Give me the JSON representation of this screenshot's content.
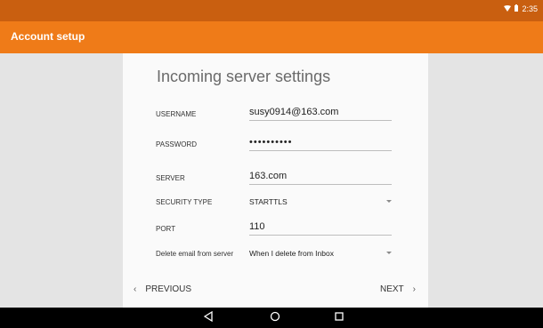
{
  "status_bar": {
    "time": "2:35",
    "icons": [
      "wifi-icon",
      "battery-icon"
    ]
  },
  "app_bar": {
    "title": "Account setup"
  },
  "form": {
    "heading": "Incoming server settings",
    "username": {
      "label": "USERNAME",
      "value": "susy0914@163.com"
    },
    "password": {
      "label": "PASSWORD",
      "value": "••••••••••"
    },
    "server": {
      "label": "SERVER",
      "value": "163.com"
    },
    "security_type": {
      "label": "SECURITY TYPE",
      "value": "STARTTLS"
    },
    "port": {
      "label": "PORT",
      "value": "110"
    },
    "delete_policy": {
      "label": "Delete email from server",
      "value": "When I delete from Inbox"
    }
  },
  "navigation": {
    "previous_label": "PREVIOUS",
    "next_label": "NEXT"
  },
  "system_nav": {
    "back": "back-icon",
    "home": "home-icon",
    "recents": "recents-icon"
  }
}
